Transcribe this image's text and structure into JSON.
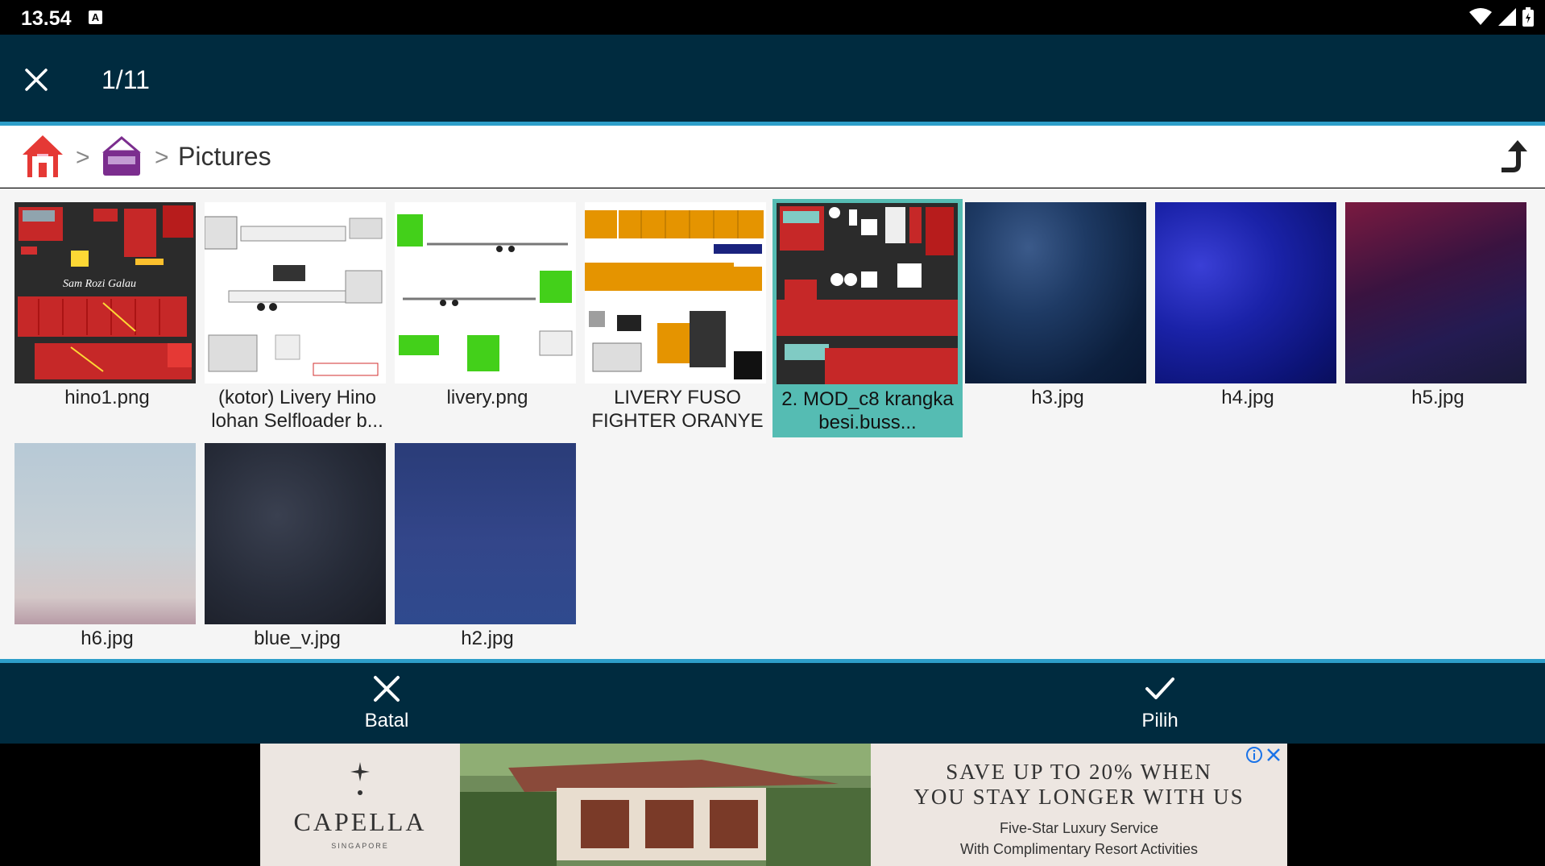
{
  "status": {
    "time": "13.54",
    "notification_glyph": "A"
  },
  "toolbar": {
    "title": "1/11"
  },
  "breadcrumb": {
    "separator": ">",
    "current": "Pictures"
  },
  "tiles": [
    {
      "name": "hino1.png",
      "selected": false
    },
    {
      "name": "(kotor) Livery Hino lohan Selfloader b...",
      "selected": false
    },
    {
      "name": "livery.png",
      "selected": false
    },
    {
      "name": "LIVERY FUSO FIGHTER ORANYE ...",
      "selected": false
    },
    {
      "name": "2. MOD_c8 krangka besi.buss...",
      "selected": true
    },
    {
      "name": "h3.jpg",
      "selected": false
    },
    {
      "name": "h4.jpg",
      "selected": false
    },
    {
      "name": "h5.jpg",
      "selected": false
    },
    {
      "name": "h6.jpg",
      "selected": false
    },
    {
      "name": "blue_v.jpg",
      "selected": false
    },
    {
      "name": "h2.jpg",
      "selected": false
    }
  ],
  "thumb_texts": {
    "hino1_watermark": "Sam Rozi Galau"
  },
  "bottom": {
    "cancel_label": "Batal",
    "confirm_label": "Pilih"
  },
  "ad": {
    "brand": "CAPELLA",
    "brand_sub": "SINGAPORE",
    "headline_1": "SAVE UP TO 20% WHEN",
    "headline_2": "YOU STAY LONGER WITH US",
    "tagline_1": "Five-Star Luxury Service",
    "tagline_2": "With Complimentary Resort Activities"
  },
  "colors": {
    "bar": "#002b3f",
    "accent": "#2d9ec9",
    "selection": "#55bcb3",
    "home_icon": "#e53935",
    "folder_icon": "#7b2d8e"
  },
  "icons": [
    "close-icon",
    "wifi-icon",
    "signal-icon",
    "battery-icon",
    "home-icon",
    "folder-icon",
    "up-arrow-icon",
    "check-icon",
    "ad-info-icon"
  ]
}
